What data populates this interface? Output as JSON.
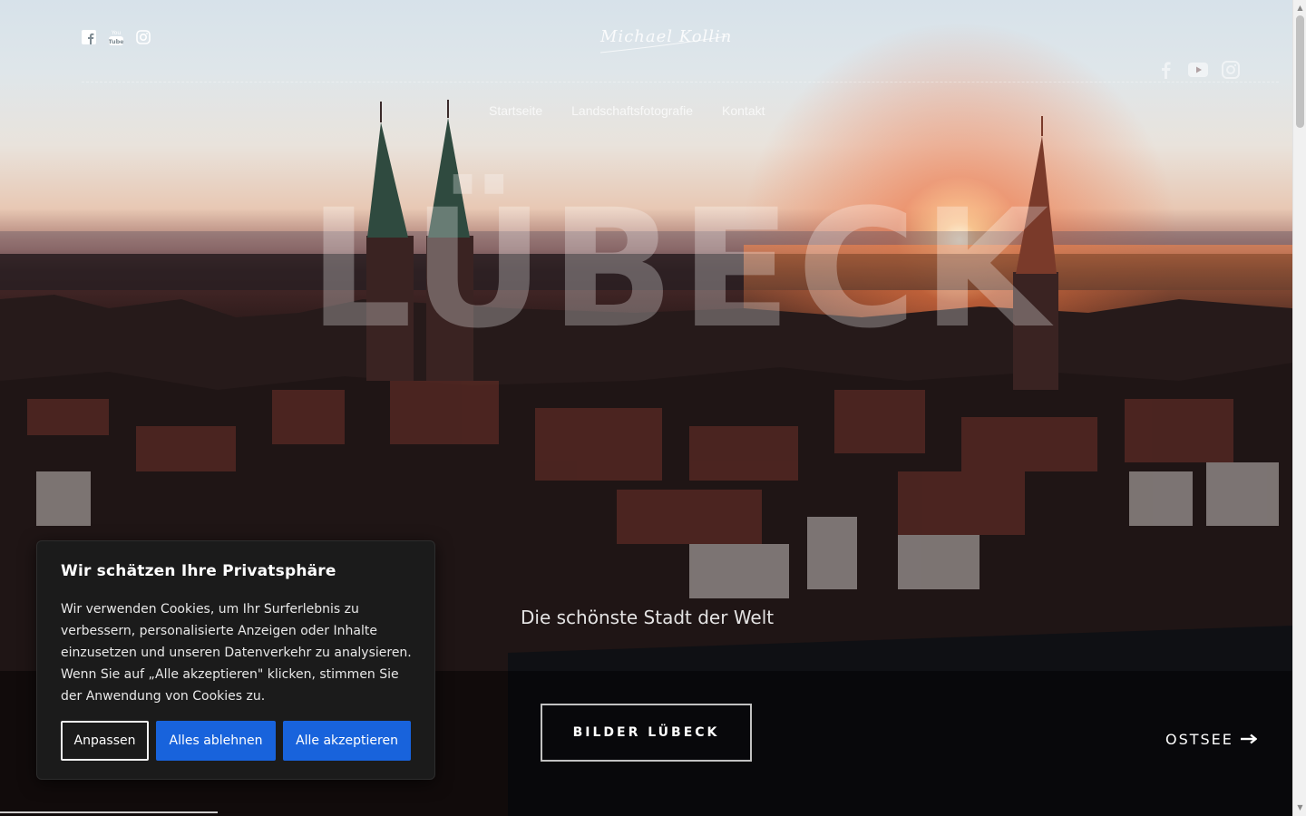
{
  "header": {
    "logo_text": "Michael Kollin",
    "social_top": [
      {
        "icon": "facebook-icon"
      },
      {
        "icon": "youtube-icon"
      },
      {
        "icon": "instagram-icon"
      }
    ],
    "social_right": [
      {
        "icon": "facebook-icon"
      },
      {
        "icon": "youtube-icon"
      },
      {
        "icon": "instagram-icon"
      }
    ]
  },
  "nav": {
    "items": [
      {
        "label": "Startseite"
      },
      {
        "label": "Landschaftsfotografie"
      },
      {
        "label": "Kontakt"
      }
    ]
  },
  "hero": {
    "title": "LÜBECK",
    "subtitle": "Die schönste Stadt der Welt",
    "cta_label": "BILDER LÜBECK",
    "next_label": "OSTSEE",
    "next_icon": "arrow-right-icon"
  },
  "cookie": {
    "title": "Wir schätzen Ihre Privatsphäre",
    "text": "Wir verwenden Cookies, um Ihr Surferlebnis zu verbessern, personalisierte Anzeigen oder Inhalte einzusetzen und unseren Datenverkehr zu analysieren. Wenn Sie auf „Alle akzeptieren\" klicken, stimmen Sie der Anwendung von Cookies zu.",
    "customize_label": "Anpassen",
    "reject_label": "Alles ablehnen",
    "accept_label": "Alle akzeptieren",
    "button_color": "#1863dc"
  }
}
